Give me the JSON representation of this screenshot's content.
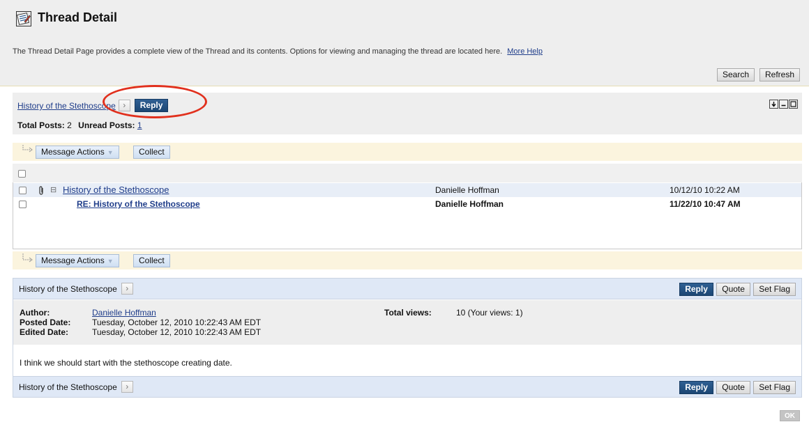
{
  "header": {
    "title": "Thread Detail",
    "description": "The Thread Detail Page provides a complete view of the Thread and its contents. Options for viewing and managing the thread are located here.",
    "more_help": "More Help",
    "icon": "thread-detail-icon",
    "search_label": "Search",
    "refresh_label": "Refresh"
  },
  "summary": {
    "thread_title": "History of the Stethoscope",
    "reply_label": "Reply",
    "total_posts_label": "Total Posts:",
    "total_posts_value": "2",
    "unread_posts_label": "Unread Posts:",
    "unread_posts_value": "1"
  },
  "actions": {
    "message_actions_label": "Message Actions",
    "collect_label": "Collect"
  },
  "messages": [
    {
      "subject": "History of the Stethoscope",
      "author": "Danielle Hoffman",
      "date": "10/12/10 10:22 AM"
    },
    {
      "subject": "RE: History of the Stethoscope",
      "author": "Danielle Hoffman",
      "date": "11/22/10 10:47 AM"
    }
  ],
  "detail": {
    "title": "History of the Stethoscope",
    "reply_label": "Reply",
    "quote_label": "Quote",
    "set_flag_label": "Set Flag",
    "author_label": "Author:",
    "author_value": "Danielle Hoffman",
    "posted_label": "Posted Date:",
    "posted_value": "Tuesday, October 12, 2010 10:22:43 AM EDT",
    "edited_label": "Edited Date:",
    "edited_value": "Tuesday, October 12, 2010 10:22:43 AM EDT",
    "total_views_label": "Total views:",
    "total_views_value": "10 (Your views: 1)",
    "body": "I think we should start with the stethoscope creating date."
  },
  "footer": {
    "ok_label": "OK"
  },
  "colors": {
    "primary_button": "#1c4774",
    "highlight": "#e1301d",
    "action_bar": "#fbf4de",
    "detail_bar": "#dfe8f6"
  }
}
